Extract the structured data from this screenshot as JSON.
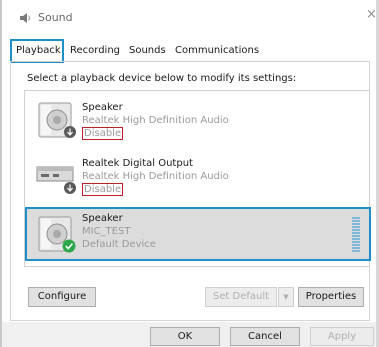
{
  "window": {
    "title": "Sound",
    "close_glyph": "×"
  },
  "tabs": [
    {
      "label": "Playback",
      "active": true
    },
    {
      "label": "Recording",
      "active": false
    },
    {
      "label": "Sounds",
      "active": false
    },
    {
      "label": "Communications",
      "active": false
    }
  ],
  "instruction": "Select a playback device below to modify its settings:",
  "devices": [
    {
      "name": "Speaker",
      "driver": "Realtek High Definition Audio",
      "status": "Disable",
      "icon": "speaker-icon",
      "badge": "disabled-down-arrow-icon"
    },
    {
      "name": "Realtek Digital Output",
      "driver": "Realtek High Definition Audio",
      "status": "Disable",
      "icon": "digital-output-icon",
      "badge": "disabled-down-arrow-icon"
    },
    {
      "name": "Speaker",
      "driver": "MIC_TEST",
      "status": "Default Device",
      "icon": "speaker-icon",
      "badge": "default-check-icon",
      "selected": true
    }
  ],
  "buttons": {
    "configure": "Configure",
    "set_default": "Set Default",
    "set_default_arrow": "▼",
    "properties": "Properties",
    "ok": "OK",
    "cancel": "Cancel",
    "apply": "Apply"
  },
  "colors": {
    "accent": "#1e8fc8",
    "disable_outline": "#c0202a",
    "check": "#2aa84a"
  }
}
